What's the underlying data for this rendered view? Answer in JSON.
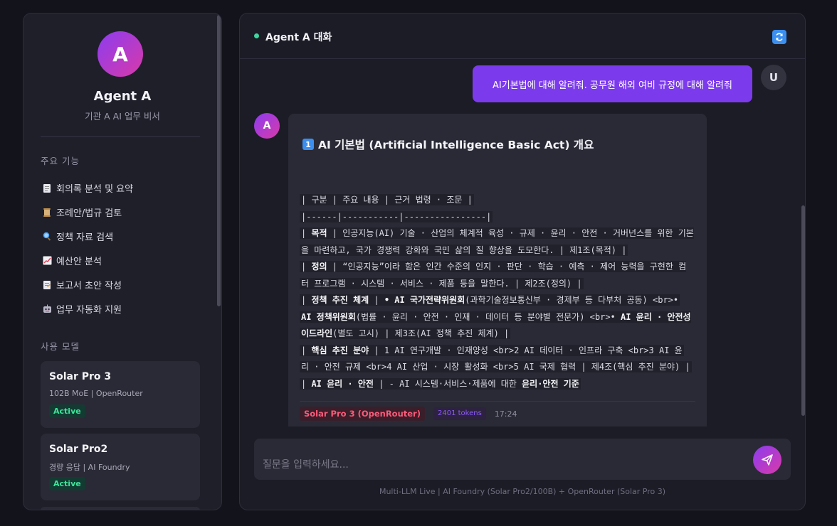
{
  "sidebar": {
    "avatar_letter": "A",
    "agent_name": "Agent A",
    "agent_subtitle": "기관 A AI 업무 비서",
    "features_title": "주요 기능",
    "features": [
      {
        "icon": "document-icon",
        "label": "회의록 분석 및 요약"
      },
      {
        "icon": "scroll-icon",
        "label": "조례안/법규 검토"
      },
      {
        "icon": "magnifier-icon",
        "label": "정책 자료 검색"
      },
      {
        "icon": "chart-increasing-icon",
        "label": "예산안 분석"
      },
      {
        "icon": "memo-icon",
        "label": "보고서 초안 작성"
      },
      {
        "icon": "robot-icon",
        "label": "업무 자동화 지원"
      }
    ],
    "models_title": "사용 모델",
    "models": [
      {
        "name": "Solar Pro 3",
        "desc": "102B MoE | OpenRouter",
        "status": "Active"
      },
      {
        "name": "Solar Pro2",
        "desc": "경량 응답 | AI Foundry",
        "status": "Active"
      }
    ]
  },
  "header": {
    "title": "Agent A 대화",
    "status_color": "#3ed69e"
  },
  "chat": {
    "user_avatar": "U",
    "user_message": "AI기본법에 대해 알려줘. 공무원 해외 여비 규정에 대해 알려줘",
    "bot_avatar": "A",
    "heading_num": "1",
    "heading": "AI 기본법 (Artificial Intelligence Basic Act) 개요",
    "lines": [
      " | 구분 | 주요 내용 | 근거 법령 · 조문 |",
      " |------|-----------|----------------|",
      [
        " | ",
        {
          "b": "목적"
        },
        " | 인공지능(AI) 기술 · 산업의 체계적 육성 · 규제 · 윤리 · 안전 · 거버넌스를 위한 기본 틀"
      ],
      "을 마련하고, 국가 경쟁력 강화와 국민 삶의 질 향상을 도모한다. | 제1조(목적) |",
      [
        " | ",
        {
          "b": "정의"
        },
        " | “인공지능”이라 함은 인간 수준의 인지 · 판단 · 학습 · 예측 · 제어 능력을 구현한 컴퓨"
      ],
      "터 프로그램 · 시스템 · 서비스 · 제품 등을 말한다. | 제2조(정의) |",
      [
        " | ",
        {
          "b": "정책 추진 체계"
        },
        " | ",
        {
          "b": "• AI 국가전략위원회"
        },
        "(과학기술정보통신부 · 경제부 등 다부처 공동) <br>•"
      ],
      [
        {
          "b": "AI 정책위원회"
        },
        "(법률 · 윤리 · 안전 · 인재 · 데이터 등 분야별 전문가) <br>• ",
        {
          "b": "AI 윤리 · 안전성 가"
        }
      ],
      [
        {
          "b": "이드라인"
        },
        "(별도 고시) | 제3조(AI 정책 추진 체계) |"
      ],
      [
        " | ",
        {
          "b": "핵심 추진 분야"
        },
        " | 1 AI 연구개발 · 인재양성 <br>2 AI 데이터 · 인프라 구축 <br>3 AI 윤"
      ],
      "리 · 안전 규제 <br>4 AI 산업 · 시장 활성화 <br>5 AI 국제 협력 | 제4조(핵심 추진 분야) |",
      [
        " | ",
        {
          "b": "AI 윤리 · 안전"
        },
        " | - AI 시스템·서비스·제품에 대한 ",
        {
          "b": "윤리·안전 기준"
        }
      ]
    ],
    "meta": {
      "model": "Solar Pro 3 (OpenRouter)",
      "tokens": "2401 tokens",
      "time": "17:24"
    }
  },
  "input": {
    "placeholder": "질문을 입력하세요..."
  },
  "footer": "Multi-LLM Live | AI Foundry (Solar Pro2/100B) + OpenRouter (Solar Pro 3)",
  "colors": {
    "accent": "#7c3aed",
    "active_green": "#3ee39a",
    "model_tag": "#ff5a7a"
  }
}
